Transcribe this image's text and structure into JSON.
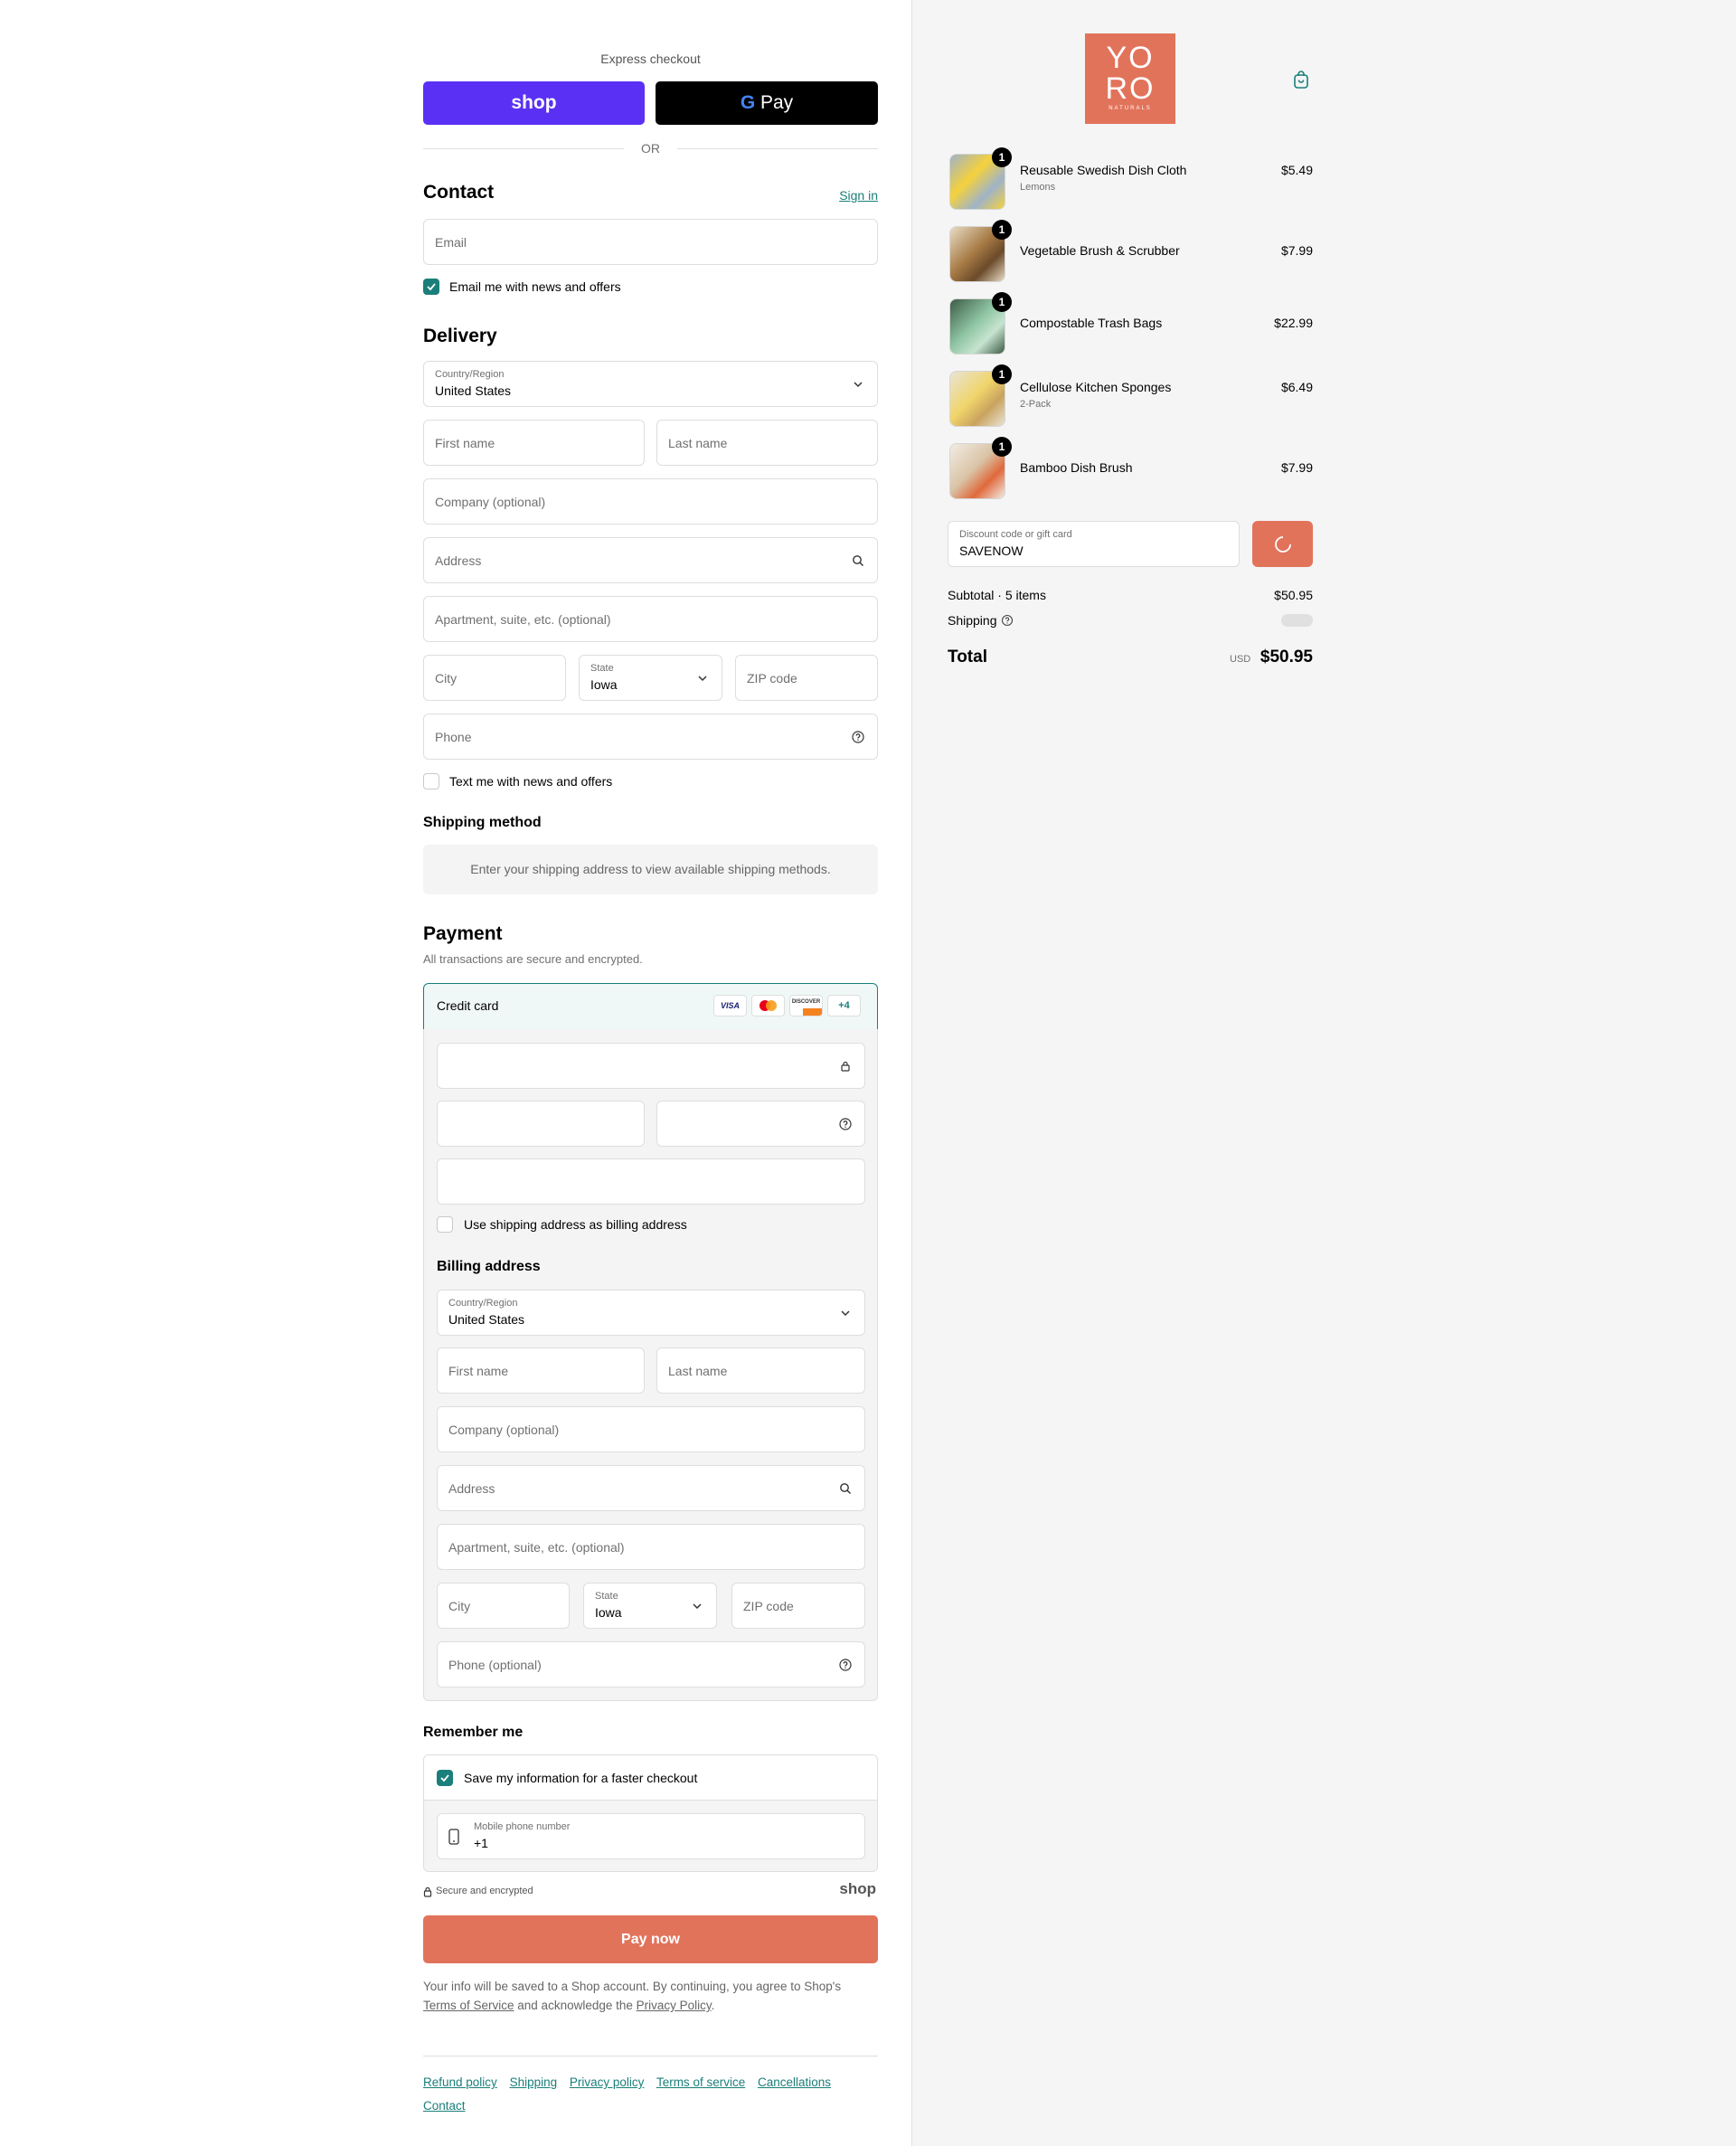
{
  "express": {
    "title": "Express checkout",
    "shop_pay": "shop",
    "gpay_g": "G",
    "gpay": "Pay",
    "or": "OR"
  },
  "contact": {
    "title": "Contact",
    "sign_in": "Sign in",
    "email_placeholder": "Email",
    "newsletter": "Email me with news and offers",
    "newsletter_checked": true
  },
  "delivery": {
    "title": "Delivery",
    "country_label": "Country/Region",
    "country": "United States",
    "first_name": "First name",
    "last_name": "Last name",
    "company": "Company (optional)",
    "address": "Address",
    "apartment": "Apartment, suite, etc. (optional)",
    "city": "City",
    "state_label": "State",
    "state": "Iowa",
    "zip": "ZIP code",
    "phone": "Phone",
    "sms": "Text me with news and offers",
    "sms_checked": false
  },
  "shipping_method": {
    "title": "Shipping method",
    "notice": "Enter your shipping address to view available shipping methods."
  },
  "payment": {
    "title": "Payment",
    "subtitle": "All transactions are secure and encrypted.",
    "method": "Credit card",
    "more_cards": "+4",
    "card_logos": [
      "visa",
      "mastercard",
      "discover"
    ],
    "visa": "VISA",
    "discover": "DISCOVER",
    "use_shipping": "Use shipping address as billing address",
    "use_shipping_checked": false
  },
  "billing": {
    "title": "Billing address",
    "country_label": "Country/Region",
    "country": "United States",
    "first_name": "First name",
    "last_name": "Last name",
    "company": "Company (optional)",
    "address": "Address",
    "apartment": "Apartment, suite, etc. (optional)",
    "city": "City",
    "state_label": "State",
    "state": "Iowa",
    "zip": "ZIP code",
    "phone": "Phone (optional)"
  },
  "remember": {
    "title": "Remember me",
    "save": "Save my information for a faster checkout",
    "save_checked": true,
    "mobile_label": "Mobile phone number",
    "mobile_value": "+1"
  },
  "secure": {
    "text": "Secure and encrypted",
    "brand": "shop"
  },
  "pay_button": "Pay now",
  "legal": {
    "line1": "Your info will be saved to a Shop account. By continuing, you agree to Shop's",
    "tos": "Terms of Service",
    "mid": " and acknowledge the ",
    "privacy": "Privacy Policy",
    "end": "."
  },
  "footer_links": [
    "Refund policy",
    "Shipping",
    "Privacy policy",
    "Terms of service",
    "Cancellations",
    "Contact"
  ],
  "brand": {
    "logo_line1": "YO",
    "logo_line2": "RO",
    "logo_sub": "NATURALS",
    "color": "#e2735b",
    "cart_icon": "shopping-bag-icon"
  },
  "cart": {
    "items": [
      {
        "name": "Reusable Swedish Dish Cloth",
        "variant": "Lemons",
        "qty": "1",
        "price": "$5.49"
      },
      {
        "name": "Vegetable Brush & Scrubber",
        "variant": "",
        "qty": "1",
        "price": "$7.99"
      },
      {
        "name": "Compostable Trash Bags",
        "variant": "",
        "qty": "1",
        "price": "$22.99"
      },
      {
        "name": "Cellulose Kitchen Sponges",
        "variant": "2-Pack",
        "qty": "1",
        "price": "$6.49"
      },
      {
        "name": "Bamboo Dish Brush",
        "variant": "",
        "qty": "1",
        "price": "$7.99"
      }
    ],
    "discount_label": "Discount code or gift card",
    "discount_value": "SAVENOW",
    "subtotal_label": "Subtotal · 5 items",
    "subtotal": "$50.95",
    "shipping_label": "Shipping",
    "total_label": "Total",
    "currency": "USD",
    "total": "$50.95"
  },
  "colors": {
    "accent": "#1a7f7a",
    "shop_purple": "#5a31f4",
    "button": "#e2735b"
  }
}
